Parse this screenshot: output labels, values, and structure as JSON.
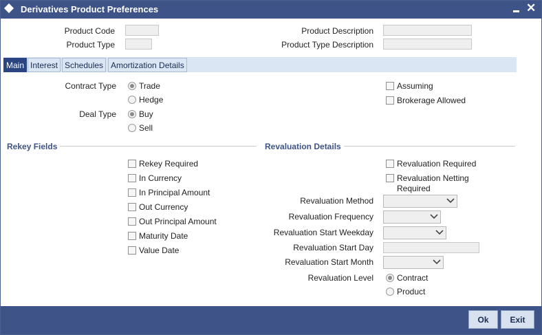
{
  "window": {
    "title": "Derivatives Product Preferences"
  },
  "header": {
    "product_code_label": "Product Code",
    "product_code_value": "",
    "product_type_label": "Product Type",
    "product_type_value": "",
    "product_description_label": "Product Description",
    "product_description_value": "",
    "product_type_description_label": "Product Type Description",
    "product_type_description_value": ""
  },
  "tabs": [
    {
      "label": "Main",
      "active": true
    },
    {
      "label": "Interest",
      "active": false
    },
    {
      "label": "Schedules",
      "active": false
    },
    {
      "label": "Amortization Details",
      "active": false
    }
  ],
  "main": {
    "contract_type_label": "Contract Type",
    "contract_type_options": [
      {
        "label": "Trade",
        "selected": true
      },
      {
        "label": "Hedge",
        "selected": false
      }
    ],
    "deal_type_label": "Deal Type",
    "deal_type_options": [
      {
        "label": "Buy",
        "selected": true
      },
      {
        "label": "Sell",
        "selected": false
      }
    ],
    "assuming_label": "Assuming",
    "brokerage_allowed_label": "Brokerage Allowed"
  },
  "rekey": {
    "section_title": "Rekey Fields",
    "items": [
      {
        "label": "Rekey Required",
        "checked": false
      },
      {
        "label": "In Currency",
        "checked": false
      },
      {
        "label": "In Principal Amount",
        "checked": false
      },
      {
        "label": "Out Currency",
        "checked": false
      },
      {
        "label": "Out Principal Amount",
        "checked": false
      },
      {
        "label": "Maturity Date",
        "checked": false
      },
      {
        "label": "Value Date",
        "checked": false
      }
    ]
  },
  "revaluation": {
    "section_title": "Revaluation Details",
    "required_label": "Revaluation Required",
    "netting_label_line1": "Revaluation Netting",
    "netting_label_line2": "Required",
    "method_label": "Revaluation Method",
    "method_value": "",
    "frequency_label": "Revaluation Frequency",
    "frequency_value": "",
    "start_weekday_label": "Revaluation Start Weekday",
    "start_weekday_value": "",
    "start_day_label": "Revaluation Start Day",
    "start_day_value": "",
    "start_month_label": "Revaluation Start Month",
    "start_month_value": "",
    "level_label": "Revaluation Level",
    "level_options": [
      {
        "label": "Contract",
        "selected": true
      },
      {
        "label": "Product",
        "selected": false
      }
    ]
  },
  "footer": {
    "ok_label": "Ok",
    "exit_label": "Exit"
  },
  "colors": {
    "titlebar": "#3e5387",
    "tab_active": "#2b4583",
    "tab_strip": "#dbe6f4",
    "section_title": "#3e5387"
  }
}
